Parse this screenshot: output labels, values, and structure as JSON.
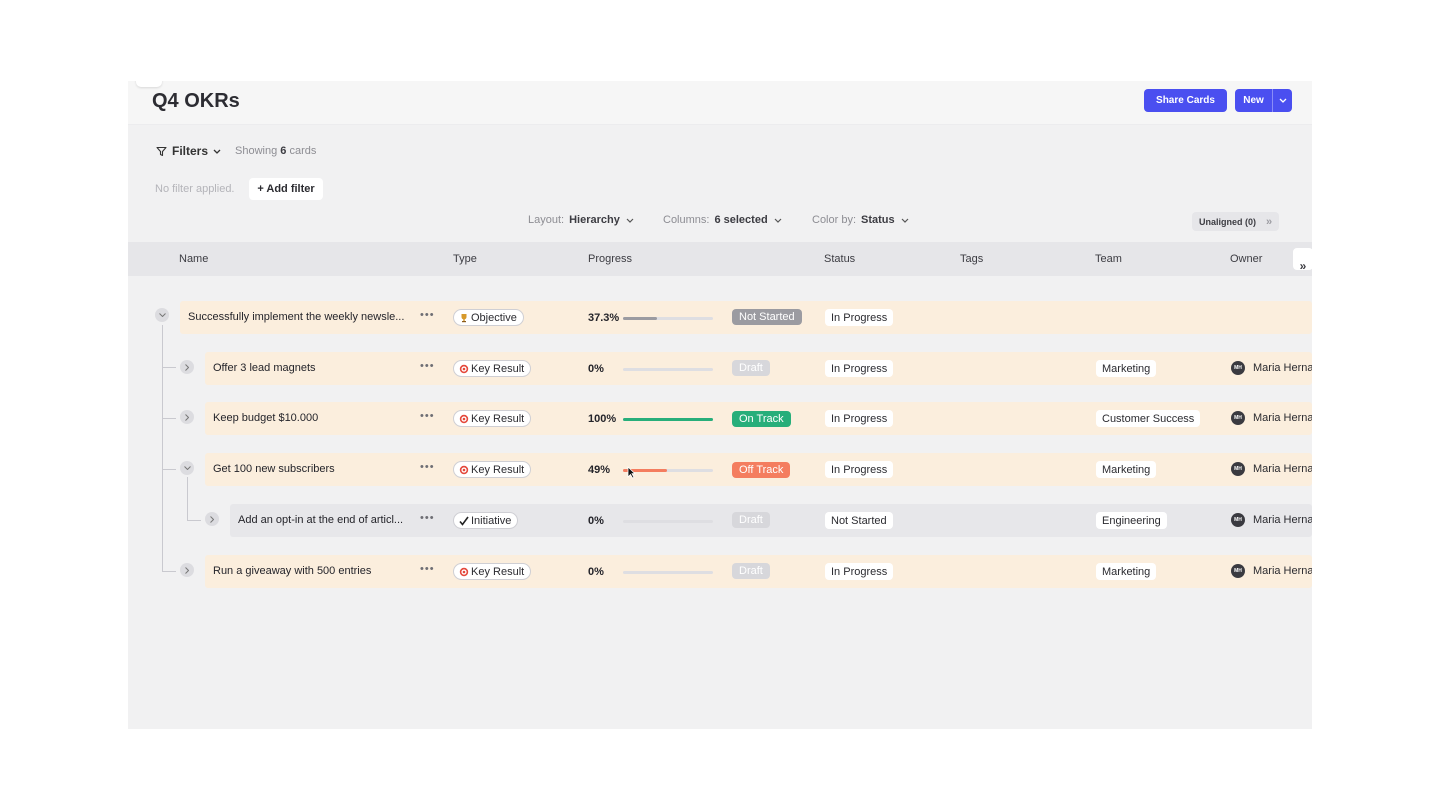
{
  "page": {
    "title": "Q4 OKRs"
  },
  "header": {
    "share_label": "Share Cards",
    "new_label": "New"
  },
  "filters": {
    "label": "Filters",
    "showing_prefix": "Showing",
    "showing_count": "6",
    "showing_suffix": "cards",
    "no_filter": "No filter applied.",
    "add_filter": "+ Add filter"
  },
  "options": {
    "layout_label": "Layout:",
    "layout_value": "Hierarchy",
    "columns_label": "Columns:",
    "columns_value": "6 selected",
    "color_label": "Color by:",
    "color_value": "Status",
    "unaligned": "Unaligned (0)"
  },
  "columns": [
    "Name",
    "Type",
    "Progress",
    "Status",
    "Tags",
    "Team",
    "Owner"
  ],
  "rows": [
    {
      "name": "Successfully implement the weekly newsle...",
      "type": "Objective",
      "type_icon": "trophy-icon",
      "progress_label": "37.3%",
      "progress": 37.3,
      "health": "Not Started",
      "health_color": "#9b9ba1",
      "status": "In Progress",
      "team": "",
      "owner": "",
      "owner_initials": ""
    },
    {
      "name": "Offer 3 lead magnets",
      "type": "Key Result",
      "type_icon": "target-icon",
      "progress_label": "0%",
      "progress": 0,
      "health": "Draft",
      "health_color": "#d7d7db",
      "status": "In Progress",
      "team": "Marketing",
      "owner": "Maria Herna",
      "owner_initials": "MH"
    },
    {
      "name": "Keep budget $10.000",
      "type": "Key Result",
      "type_icon": "target-icon",
      "progress_label": "100%",
      "progress": 100,
      "health": "On Track",
      "health_color": "#27ae7a",
      "status": "In Progress",
      "team": "Customer Success",
      "owner": "Maria Herna",
      "owner_initials": "MH"
    },
    {
      "name": "Get 100 new subscribers",
      "type": "Key Result",
      "type_icon": "target-icon",
      "progress_label": "49%",
      "progress": 49,
      "health": "Off Track",
      "health_color": "#f47d5f",
      "status": "In Progress",
      "team": "Marketing",
      "owner": "Maria Herna",
      "owner_initials": "MH"
    },
    {
      "name": "Add an opt-in at the end of articl...",
      "type": "Initiative",
      "type_icon": "check-icon",
      "progress_label": "0%",
      "progress": 0,
      "health": "Draft",
      "health_color": "#d7d7db",
      "status": "Not Started",
      "team": "Engineering",
      "owner": "Maria Herna",
      "owner_initials": "MH"
    },
    {
      "name": "Run a giveaway with 500 entries",
      "type": "Key Result",
      "type_icon": "target-icon",
      "progress_label": "0%",
      "progress": 0,
      "health": "Draft",
      "health_color": "#d7d7db",
      "status": "In Progress",
      "team": "Marketing",
      "owner": "Maria Herna",
      "owner_initials": "MH"
    }
  ],
  "colors": {
    "accent": "#4a4ff0",
    "row_objective": "#fbeedd",
    "row_initiative": "#e7e7ea",
    "progress_objective": "#9b9ba1",
    "progress_on_track": "#27ae7a",
    "progress_off_track": "#f47d5f"
  }
}
